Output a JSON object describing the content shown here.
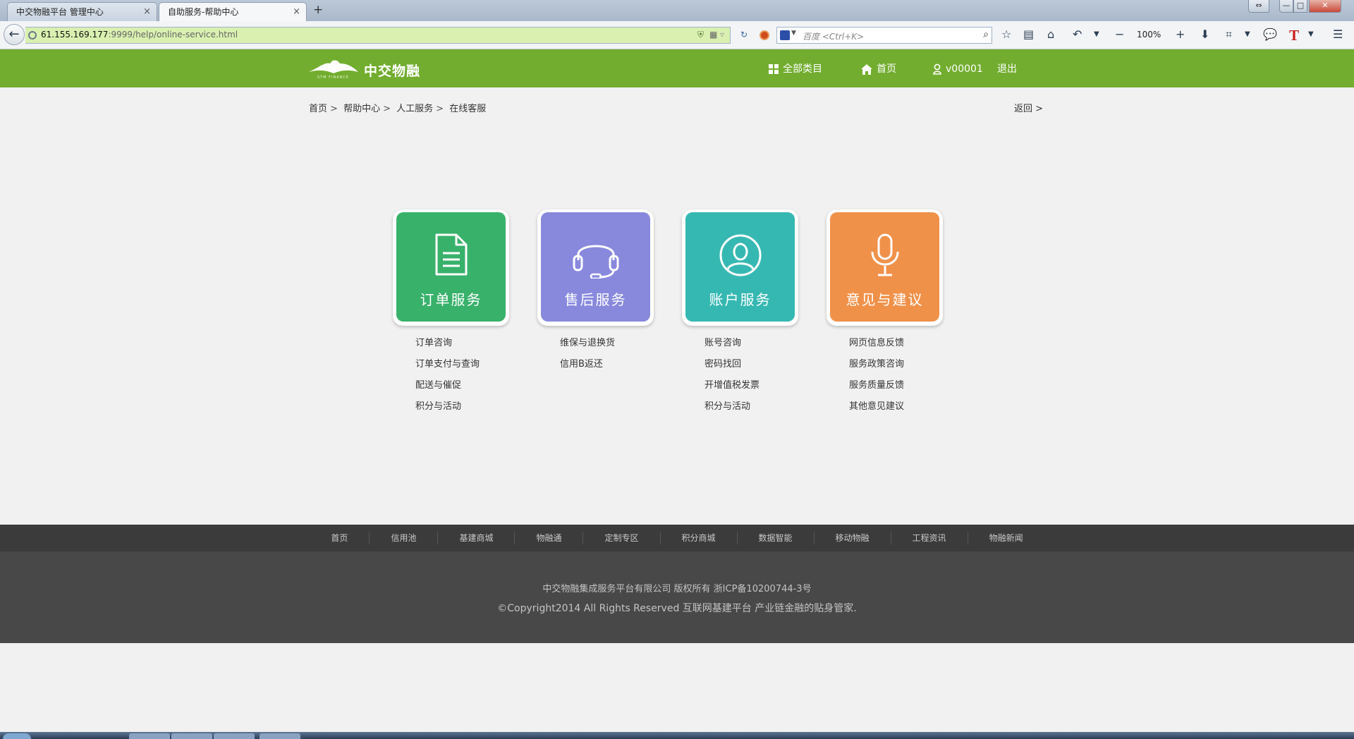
{
  "browser": {
    "tabs": [
      {
        "label": "中交物融平台 管理中心",
        "active": false
      },
      {
        "label": "自助服务-帮助中心",
        "active": true
      }
    ],
    "close_glyph": "×",
    "new_tab_glyph": "+",
    "url_host": "61.155.169.177",
    "url_rest": ":9999/help/online-service.html",
    "search_placeholder": "百度 <Ctrl+K>",
    "zoom": "100%",
    "window_controls": {
      "min": "—",
      "max": "□",
      "close": "✕"
    }
  },
  "header": {
    "logo_cn": "中交物融",
    "logo_en": "STM FINANCE",
    "nav": {
      "categories": "全部类目",
      "home": "首页",
      "user": "v00001",
      "logout": "退出"
    }
  },
  "breadcrumb": {
    "items": [
      "首页",
      "帮助中心",
      "人工服务",
      "在线客服"
    ],
    "separator": ">",
    "back": "返回 >"
  },
  "services": [
    {
      "title": "订单服务",
      "icon": "document-icon",
      "color": "#38b16b",
      "links": [
        "订单咨询",
        "订单支付与查询",
        "配送与催促",
        "积分与活动"
      ]
    },
    {
      "title": "售后服务",
      "icon": "headset-icon",
      "color": "#8889dd",
      "links": [
        "维保与退换货",
        "信用B返还"
      ]
    },
    {
      "title": "账户服务",
      "icon": "user-icon",
      "color": "#36b8b2",
      "links": [
        "账号咨询",
        "密码找回",
        "开增值税发票",
        "积分与活动"
      ]
    },
    {
      "title": "意见与建议",
      "icon": "microphone-icon",
      "color": "#f0914a",
      "links": [
        "网页信息反馈",
        "服务政策咨询",
        "服务质量反馈",
        "其他意见建议"
      ]
    }
  ],
  "footer": {
    "nav": [
      "首页",
      "信用池",
      "基建商城",
      "物融通",
      "定制专区",
      "积分商城",
      "数据智能",
      "移动物融",
      "工程资讯",
      "物融新闻"
    ],
    "line1": "中交物融集成服务平台有限公司  版权所有  浙ICP备10200744-3号",
    "line2": "©Copyright2014 All Rights Reserved  互联网基建平台  产业链金融的贴身管家."
  },
  "colors": {
    "brand_green": "#72ad2f",
    "footer_dark": "#484848",
    "footer_nav": "#3b3b3b"
  }
}
